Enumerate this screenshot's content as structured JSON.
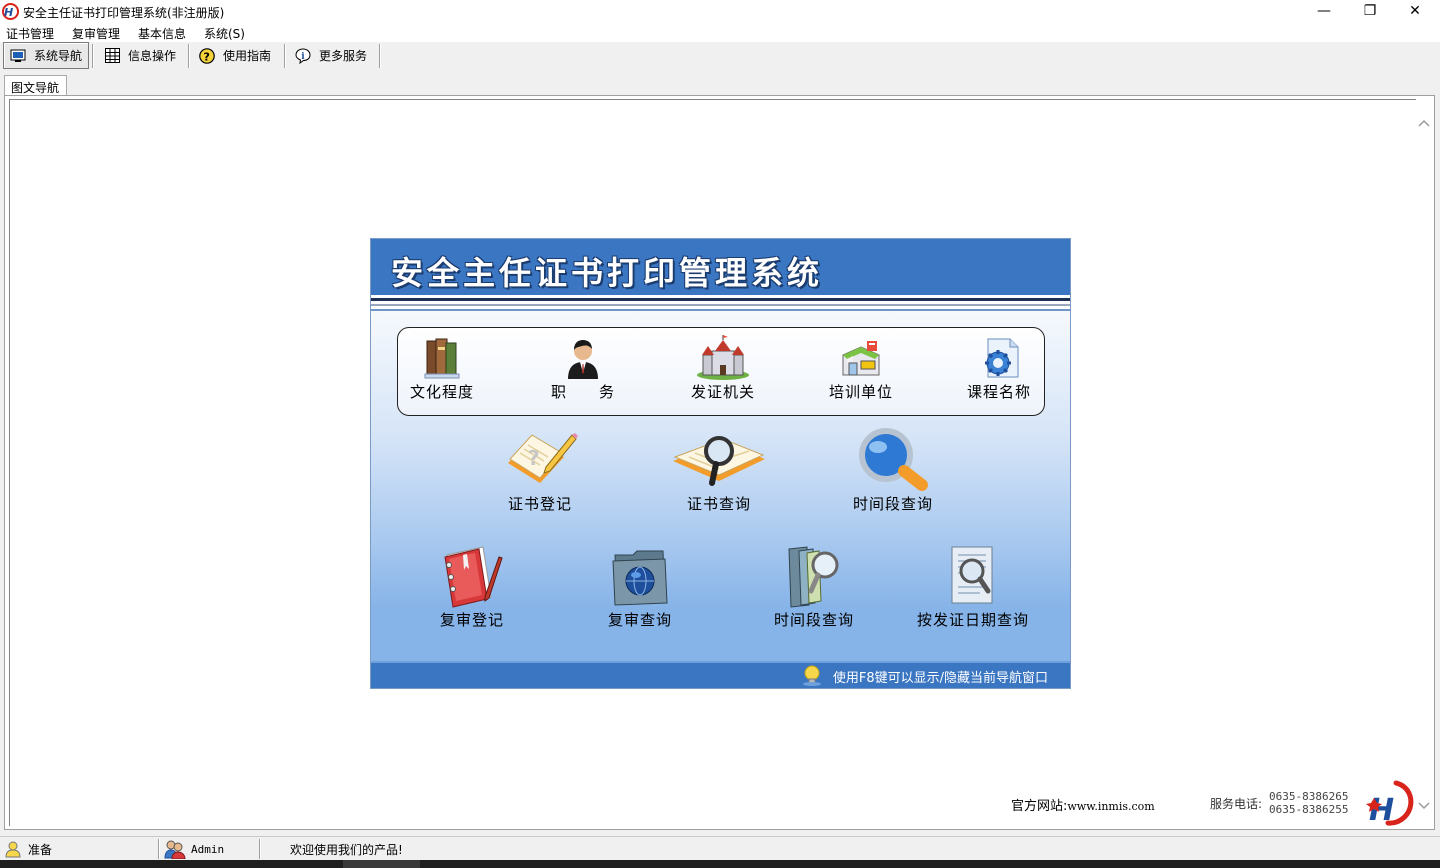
{
  "window": {
    "title": "安全主任证书打印管理系统(非注册版)",
    "minimize_glyph": "—",
    "restore_glyph": "❐",
    "close_glyph": "✕"
  },
  "menu": [
    "证书管理",
    "复审管理",
    "基本信息",
    "系统(S)"
  ],
  "toolbar": [
    {
      "label": "系统导航",
      "icon": "monitor-icon",
      "active": true
    },
    {
      "label": "信息操作",
      "icon": "grid-icon",
      "active": false
    },
    {
      "label": "使用指南",
      "icon": "help-icon",
      "active": false
    },
    {
      "label": "更多服务",
      "icon": "info-icon",
      "active": false
    }
  ],
  "tab": {
    "label": "图文导航"
  },
  "nav_panel": {
    "title": "安全主任证书打印管理系统",
    "row1": [
      {
        "label": "文化程度",
        "icon": "books-icon"
      },
      {
        "label": "职　　务",
        "icon": "person-icon"
      },
      {
        "label": "发证机关",
        "icon": "castle-icon"
      },
      {
        "label": "培训单位",
        "icon": "shop-icon"
      },
      {
        "label": "课程名称",
        "icon": "document-gear-icon"
      }
    ],
    "row2": [
      {
        "label": "证书登记",
        "icon": "notepad-pencil-icon"
      },
      {
        "label": "证书查询",
        "icon": "book-magnifier-icon"
      },
      {
        "label": "时间段查询",
        "icon": "magnifier-icon"
      }
    ],
    "row3": [
      {
        "label": "复审登记",
        "icon": "red-notebook-icon"
      },
      {
        "label": "复审查询",
        "icon": "folder-globe-icon"
      },
      {
        "label": "时间段查询",
        "icon": "folder-magnifier-icon"
      },
      {
        "label": "按发证日期查询",
        "icon": "page-magnifier-icon"
      }
    ],
    "footer_tip": "使用F8键可以显示/隐藏当前导航窗口"
  },
  "site": {
    "label": "官方网站:",
    "url": "www.inmis.com",
    "phone_label": "服务电话:",
    "phone1": "0635-8386265",
    "phone2": "0635-8386255"
  },
  "status": {
    "ready": "准备",
    "user": "Admin",
    "welcome": "欢迎使用我们的产品!"
  },
  "colors": {
    "header_blue": "#3b76c3",
    "brand_red": "#d9241c",
    "brand_blue": "#1d4f9c"
  }
}
